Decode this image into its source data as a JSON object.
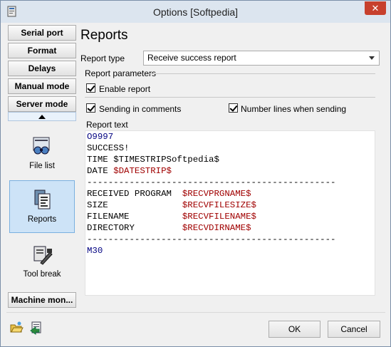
{
  "window": {
    "title": "Options [Softpedia]",
    "close_glyph": "✕"
  },
  "sidebar": {
    "buttons": [
      "Serial port",
      "Format",
      "Delays",
      "Manual mode",
      "Server mode"
    ],
    "big_items": [
      "File list",
      "Reports",
      "Tool break"
    ],
    "bottom_button": "Machine mon...",
    "selected": "Reports"
  },
  "main": {
    "heading": "Reports",
    "report_type_label": "Report type",
    "report_type_value": "Receive success report",
    "parameters_label": "Report parameters",
    "enable_report_label": "Enable report",
    "enable_report_checked": true,
    "sending_in_comments_label": "Sending in comments",
    "sending_in_comments_checked": true,
    "number_lines_label": "Number lines when sending",
    "number_lines_checked": true,
    "report_text_label": "Report text",
    "report_lines": [
      [
        {
          "t": "O9997",
          "c": "navy"
        }
      ],
      [
        {
          "t": "SUCCESS!",
          "c": "black"
        }
      ],
      [
        {
          "t": "TIME ",
          "c": "black"
        },
        {
          "t": "$TIMESTRIPSoftpedia$",
          "c": "black"
        }
      ],
      [
        {
          "t": "DATE ",
          "c": "black"
        },
        {
          "t": "$DATESTRIP$",
          "c": "red"
        }
      ],
      [
        {
          "t": "-----------------------------------------------",
          "c": "black"
        }
      ],
      [
        {
          "t": "RECEIVED PROGRAM  ",
          "c": "black"
        },
        {
          "t": "$RECVPRGNAME$",
          "c": "red"
        }
      ],
      [
        {
          "t": "SIZE              ",
          "c": "black"
        },
        {
          "t": "$RECVFILESIZE$",
          "c": "red"
        }
      ],
      [
        {
          "t": "FILENAME          ",
          "c": "black"
        },
        {
          "t": "$RECVFILENAME$",
          "c": "red"
        }
      ],
      [
        {
          "t": "DIRECTORY         ",
          "c": "black"
        },
        {
          "t": "$RECVDIRNAME$",
          "c": "red"
        }
      ],
      [
        {
          "t": "-----------------------------------------------",
          "c": "black"
        }
      ],
      [
        {
          "t": "M30",
          "c": "navy"
        }
      ]
    ]
  },
  "footer": {
    "ok_label": "OK",
    "cancel_label": "Cancel"
  },
  "colors": {
    "titlebar": "#dce5ef",
    "close": "#c7402d",
    "selected_bg": "#cde3f7",
    "navy_text": "#000080",
    "red_text": "#a00000"
  }
}
